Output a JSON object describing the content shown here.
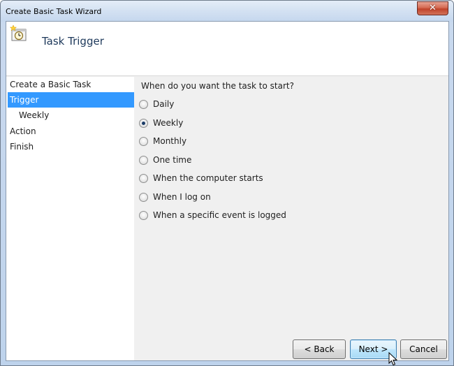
{
  "window": {
    "title": "Create Basic Task Wizard",
    "close_glyph": "✕"
  },
  "header": {
    "title": "Task Trigger",
    "icon": "clock-calendar-icon"
  },
  "sidebar": {
    "items": [
      {
        "label": "Create a Basic Task",
        "selected": false,
        "sub": false
      },
      {
        "label": "Trigger",
        "selected": true,
        "sub": false
      },
      {
        "label": "Weekly",
        "selected": false,
        "sub": true
      },
      {
        "label": "Action",
        "selected": false,
        "sub": false
      },
      {
        "label": "Finish",
        "selected": false,
        "sub": false
      }
    ]
  },
  "content": {
    "question": "When do you want the task to start?",
    "options": [
      {
        "label": "Daily",
        "checked": false
      },
      {
        "label": "Weekly",
        "checked": true
      },
      {
        "label": "Monthly",
        "checked": false
      },
      {
        "label": "One time",
        "checked": false
      },
      {
        "label": "When the computer starts",
        "checked": false
      },
      {
        "label": "When I log on",
        "checked": false
      },
      {
        "label": "When a specific event is logged",
        "checked": false
      }
    ]
  },
  "buttons": {
    "back": "< Back",
    "next": "Next >",
    "cancel": "Cancel"
  },
  "colors": {
    "selection": "#3399ff",
    "header_text": "#1e395b"
  }
}
